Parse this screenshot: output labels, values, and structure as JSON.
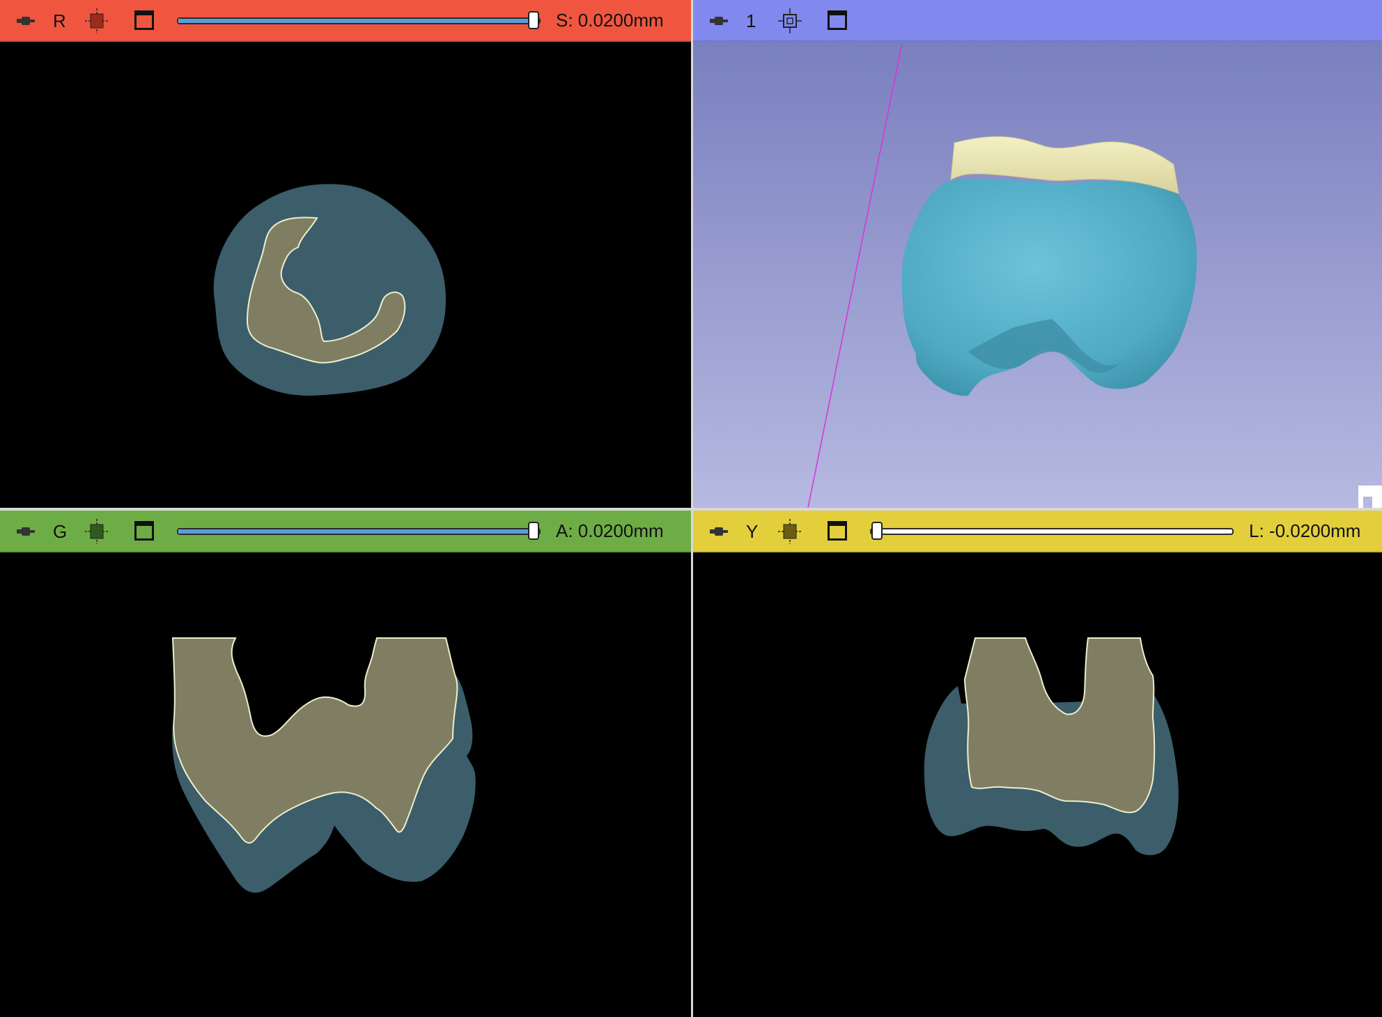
{
  "views": {
    "red": {
      "label": "R",
      "offset_text": "S: 0.0200mm",
      "slider_value": 1.0,
      "bar_color": "#f0563f"
    },
    "threed": {
      "label": "1",
      "bar_color": "#8189ee",
      "background_top": "#7a7fbf",
      "background_bottom": "#b6b9e0"
    },
    "green": {
      "label": "G",
      "offset_text": "A: 0.0200mm",
      "slider_value": 1.0,
      "bar_color": "#6ead45"
    },
    "yellow": {
      "label": "Y",
      "offset_text": "L: -0.0200mm",
      "slider_value": 0.0,
      "bar_color": "#e3cf3c"
    }
  },
  "segments": {
    "outer_color": "#3c5d6a",
    "inner_color": "#7f7e62",
    "inner_outline": "#eeeecd",
    "model_blue": "#5bb3cc",
    "model_cap": "#ede9b6",
    "slice_line_color": "#d833d8"
  },
  "icons": {
    "pin": "pin-icon",
    "layers": "layer-visibility-icon",
    "maximize": "maximize-view-icon",
    "center": "center-view-icon"
  }
}
